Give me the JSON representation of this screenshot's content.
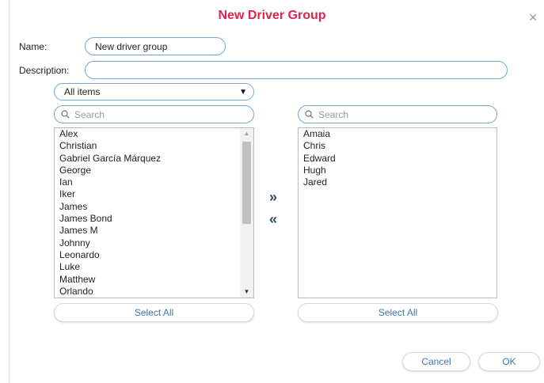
{
  "dialog": {
    "title": "New Driver Group",
    "close_icon": "close-icon"
  },
  "form": {
    "name_label": "Name:",
    "name_value": "New driver group",
    "description_label": "Description:",
    "description_value": ""
  },
  "filter": {
    "selected": "All items"
  },
  "left_panel": {
    "search_placeholder": "Search",
    "items": [
      "Alex",
      "Christian",
      "Gabriel García Márquez",
      "George",
      "Ian",
      "Iker",
      "James",
      "James Bond",
      "James M",
      "Johnny",
      "Leonardo",
      "Luke",
      "Matthew",
      "Orlando"
    ],
    "select_all_label": "Select All"
  },
  "right_panel": {
    "search_placeholder": "Search",
    "items": [
      "Amaia",
      "Chris",
      "Edward",
      "Hugh",
      "Jared"
    ],
    "select_all_label": "Select All"
  },
  "transfer": {
    "add_label": "»",
    "remove_label": "«"
  },
  "footer": {
    "cancel_label": "Cancel",
    "ok_label": "OK"
  },
  "colors": {
    "title": "#e0234e",
    "input_border": "#6fa8d6",
    "button_text": "#3a78b5"
  }
}
